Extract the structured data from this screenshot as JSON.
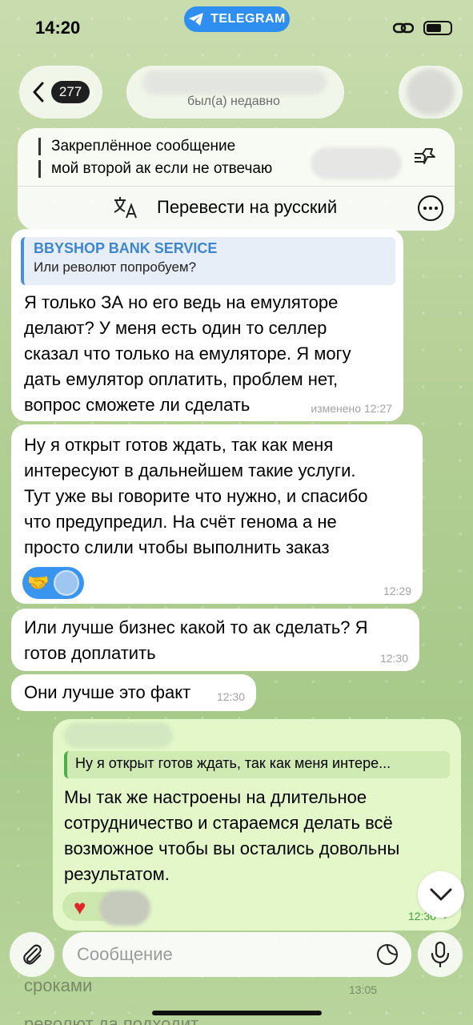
{
  "status_bar": {
    "time": "14:20",
    "app_pill": "TELEGRAM"
  },
  "header": {
    "back_count": "277",
    "last_seen": "был(а) недавно"
  },
  "pinned": {
    "title": "Закреплённое сообщение",
    "text": "мой второй ак если не отвечаю",
    "translate_label": "Перевести на русский"
  },
  "messages": [
    {
      "reply_name": "BBYSHOP BANK SERVICE",
      "reply_text": "Или револют попробуем?",
      "lines": [
        "Я только ЗА но его ведь на емуляторе",
        "делают? У меня есть один то селлер",
        "сказал что только на емуляторе. Я могу",
        "дать емулятор оплатить, проблем нет,",
        "вопрос сможете ли сделать"
      ],
      "meta": "изменено 12:27"
    },
    {
      "lines": [
        "Ну я открыт готов ждать, так как меня",
        "интересуют в дальнейшем такие услуги.",
        "Тут уже вы говорите что нужно, и спасибо",
        "что предупредил. На счёт генома а не",
        "просто слили чтобы выполнить заказ"
      ],
      "reaction": "🤝",
      "meta": "12:29"
    },
    {
      "lines": [
        "Или лучше бизнес какой то ак сделать? Я",
        "готов доплатить"
      ],
      "meta": "12:30"
    },
    {
      "lines": [
        "Они лучше это факт"
      ],
      "meta": "12:30"
    }
  ],
  "outgoing": {
    "reply_text": "Ну я открыт готов ждать, так как меня интере...",
    "lines": [
      "Мы так же настроены на длительное",
      "сотрудничество и стараемся делать всё",
      "возможное чтобы вы остались довольны",
      "результатом."
    ],
    "reaction": "♥",
    "time": "12:30"
  },
  "background_messages": {
    "line1": "сроками",
    "time1": "13:05",
    "line2": "револют да подходит"
  },
  "composer": {
    "placeholder": "Сообщение"
  }
}
